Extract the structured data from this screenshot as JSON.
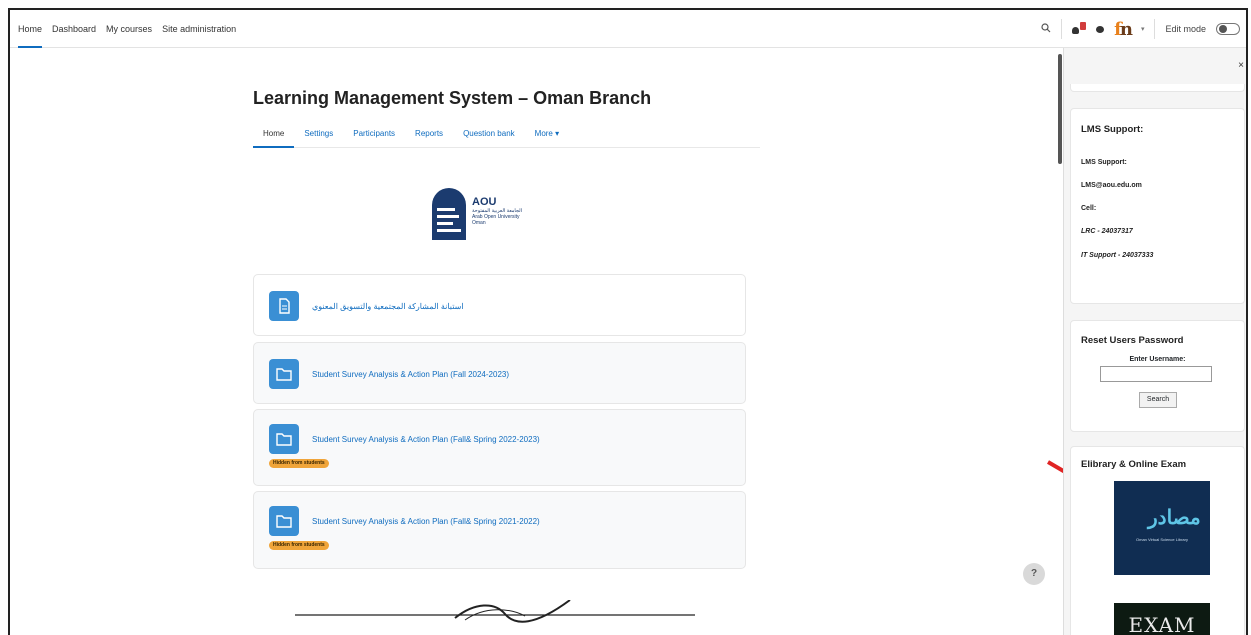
{
  "topnav": {
    "items": [
      {
        "label": "Home",
        "active": true
      },
      {
        "label": "Dashboard"
      },
      {
        "label": "My courses"
      },
      {
        "label": "Site administration"
      }
    ],
    "edit_mode_label": "Edit mode",
    "icons": [
      "search-icon",
      "notification-bell-icon",
      "messages-icon",
      "user-avatar",
      "chevron-down-icon",
      "toggle-switch"
    ]
  },
  "course": {
    "title": "Learning Management System – Oman Branch",
    "tabs": [
      "Home",
      "Settings",
      "Participants",
      "Reports",
      "Question bank",
      "More ▾"
    ],
    "active_tab": "Home",
    "logo": {
      "name": "AOU",
      "arabic": "الجامعة العربية المفتوحة",
      "english": "Arab Open University",
      "country": "Oman"
    },
    "activities": [
      {
        "name": "استبانة المشاركة المجتمعية والتسويق المعنوي",
        "icon": "file-icon",
        "hidden": false
      },
      {
        "name": "Student Survey Analysis & Action Plan (Fall 2024-2023)",
        "icon": "folder-icon",
        "hidden": false
      },
      {
        "name": "Student Survey Analysis & Action Plan (Fall& Spring 2022-2023)",
        "icon": "folder-icon",
        "hidden": true
      },
      {
        "name": "Student Survey Analysis & Action Plan (Fall& Spring 2021-2022)",
        "icon": "folder-icon",
        "hidden": true
      }
    ],
    "hidden_badge": "Hidden from students",
    "help_label": "?"
  },
  "drawer": {
    "close_label": "×",
    "support": {
      "title": "LMS Support:",
      "lines": [
        "LMS Support:",
        "LMS@aou.edu.om",
        "Cell:",
        "LRC - 24037317",
        "IT Support - 24037333"
      ]
    },
    "reset": {
      "title": "Reset Users Password",
      "label": "Enter Username:",
      "button": "Search"
    },
    "elibrary": {
      "title": "Elibrary & Online Exam",
      "masader_text": "مصادر",
      "masader_sub": "Oman Virtual Science Library",
      "exam_text": "EXAM"
    }
  },
  "colors": {
    "link": "#0f6cbf",
    "activity_icon": "#3a8fd4",
    "hidden_badge": "#f0a53a",
    "annotation_arrow": "#e02424"
  }
}
